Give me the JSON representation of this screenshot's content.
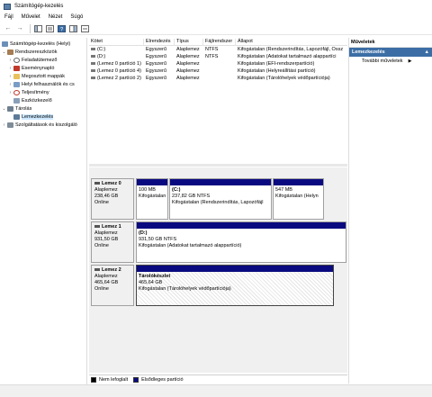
{
  "window": {
    "title": "Számítógép-kezelés"
  },
  "menu": {
    "items": [
      "Fájl",
      "Művelet",
      "Nézet",
      "Súgó"
    ]
  },
  "toolbar": {
    "icons": [
      "back-arrow-icon",
      "forward-arrow-icon",
      "console-tree-icon",
      "properties-icon",
      "help-icon",
      "show-hide-icon",
      "export-icon"
    ]
  },
  "tree": {
    "root": "Számítógép-kezelés (Helyi)",
    "system_tools": "Rendszereszközök",
    "task_scheduler": "Feladatütemező",
    "event_viewer": "Eseménynapló",
    "shared_folders": "Megosztott mappák",
    "local_users": "Helyi felhasználók és cs",
    "performance": "Teljesítmény",
    "device_manager": "Eszközkezelő",
    "storage": "Tárolás",
    "disk_management": "Lemezkezelés",
    "services": "Szolgáltatások és kiszolgáló"
  },
  "volume_list": {
    "headers": [
      "Kötet",
      "Elrendezés",
      "Típus",
      "Fájlrendszer",
      "Állapot"
    ],
    "rows": [
      [
        "(C:)",
        "Egyszerű",
        "Alaplemez",
        "NTFS",
        "Kifogástalan (Rendszerindítás, Lapozófájl, Össz"
      ],
      [
        "(D:)",
        "Egyszerű",
        "Alaplemez",
        "NTFS",
        "Kifogástalan (Adatokat tartalmazó alappartíci"
      ],
      [
        "(Lemez 0 partíció 1)",
        "Egyszerű",
        "Alaplemez",
        "",
        "Kifogástalan (EFI-rendszerpartíció)"
      ],
      [
        "(Lemez 0 partíció 4)",
        "Egyszerű",
        "Alaplemez",
        "",
        "Kifogástalan (Helyreállítási partíció)"
      ],
      [
        "(Lemez 2 partíció 2)",
        "Egyszerű",
        "Alaplemez",
        "",
        "Kifogástalan (Tárolóhelyek védőpartíciója)"
      ]
    ]
  },
  "disks": [
    {
      "name": "Lemez 0",
      "type": "Alaplemez",
      "size": "238,46 GB",
      "status": "Online",
      "partitions": [
        {
          "label": "",
          "size": "100 MB",
          "status": "Kifogástalan"
        },
        {
          "label": "(C:)",
          "size": "237,82 GB NTFS",
          "status": "Kifogástalan (Rendszerindítás, Lapozófájl"
        },
        {
          "label": "",
          "size": "547 MB",
          "status": "Kifogástalan (Helyn"
        }
      ]
    },
    {
      "name": "Lemez 1",
      "type": "Alaplemez",
      "size": "931,50 GB",
      "status": "Online",
      "partitions": [
        {
          "label": "(D:)",
          "size": "931,50 GB NTFS",
          "status": "Kifogástalan (Adatokat tartalmazó alappartíció)"
        }
      ]
    },
    {
      "name": "Lemez 2",
      "type": "Alaplemez",
      "size": "465,64 GB",
      "status": "Online",
      "partitions": [
        {
          "label": "Tárolókészlet",
          "size": "465,64 GB",
          "status": "Kifogástalan (Tárolóhelyek védőpartíciója)"
        }
      ]
    }
  ],
  "legend": {
    "unallocated": "Nem lefoglalt",
    "primary": "Elsődleges partíció",
    "unallocated_color": "#000000",
    "primary_color": "#0a0a80"
  },
  "actions": {
    "header": "Műveletek",
    "section": "Lemezkezelés",
    "more": "További műveletek"
  }
}
